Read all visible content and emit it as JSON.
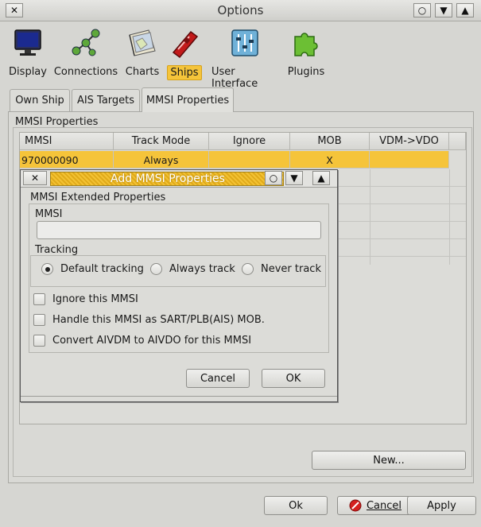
{
  "window": {
    "title": "Options",
    "close_glyph": "✕",
    "controls": [
      "○",
      "▼",
      "▲"
    ]
  },
  "toolbar": [
    {
      "label": "Display",
      "icon": "monitor-icon",
      "selected": false
    },
    {
      "label": "Connections",
      "icon": "network-icon",
      "selected": false
    },
    {
      "label": "Charts",
      "icon": "charts-icon",
      "selected": false
    },
    {
      "label": "Ships",
      "icon": "ship-icon",
      "selected": true
    },
    {
      "label": "User Interface",
      "icon": "sliders-icon",
      "selected": false
    },
    {
      "label": "Plugins",
      "icon": "puzzle-icon",
      "selected": false
    }
  ],
  "tabs": [
    {
      "label": "Own Ship",
      "active": false
    },
    {
      "label": "AIS Targets",
      "active": false
    },
    {
      "label": "MMSI Properties",
      "active": true
    }
  ],
  "mmsi_group": {
    "title": "MMSI Properties"
  },
  "table": {
    "columns": [
      "MMSI",
      "Track Mode",
      "Ignore",
      "MOB",
      "VDM->VDO"
    ],
    "rows": [
      {
        "mmsi": "970000090",
        "track_mode": "Always",
        "ignore": "",
        "mob": "X",
        "vdm_vdo": "",
        "selected": true
      }
    ]
  },
  "new_button": "New...",
  "dialog": {
    "title": "Add MMSI Properties",
    "group_title": "MMSI Extended Properties",
    "mmsi_label": "MMSI",
    "mmsi_value": "",
    "tracking_label": "Tracking",
    "tracking_options": [
      {
        "label": "Default tracking",
        "checked": true
      },
      {
        "label": "Always track",
        "checked": false
      },
      {
        "label": "Never track",
        "checked": false
      }
    ],
    "checkboxes": [
      {
        "label": "Ignore this MMSI",
        "checked": false
      },
      {
        "label": "Handle this MMSI as SART/PLB(AIS) MOB.",
        "checked": false
      },
      {
        "label": "Convert AIVDM to AIVDO for this MMSI",
        "checked": false
      }
    ],
    "cancel_label": "Cancel",
    "ok_label": "OK"
  },
  "footer": {
    "ok_label": "Ok",
    "cancel_label": "Cancel",
    "apply_label": "Apply"
  },
  "colors": {
    "selection": "#f5c43a",
    "background": "#d6d6d2"
  }
}
